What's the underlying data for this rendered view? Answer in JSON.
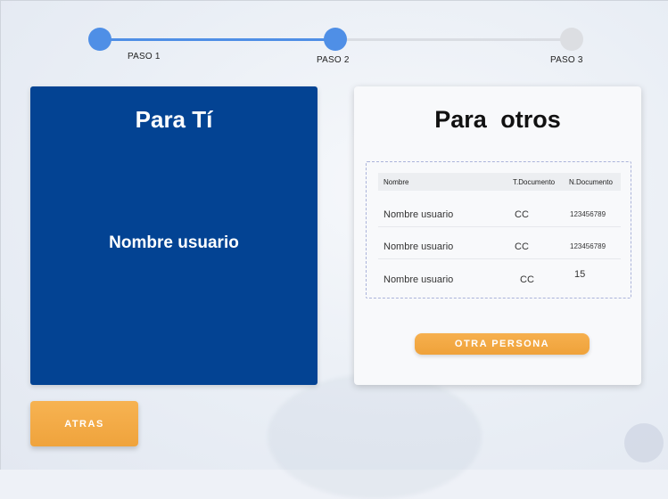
{
  "stepper": {
    "steps": [
      {
        "label": "PASO 1",
        "state": "completed"
      },
      {
        "label": "PASO 2",
        "state": "active"
      },
      {
        "label": "PASO 3",
        "state": "pending"
      }
    ],
    "active_color": "#4f8fe6",
    "inactive_color": "#dcdee2"
  },
  "self_card": {
    "title": "Para Tí",
    "user_name": "Nombre usuario",
    "color": "#034393"
  },
  "others_card": {
    "title": "Para  otros",
    "table": {
      "headers": [
        "Nombre",
        "T.Documento",
        "N.Documento"
      ],
      "rows": [
        [
          "Nombre usuario",
          "CC",
          "123456789"
        ],
        [
          "Nombre usuario",
          "CC",
          "123456789"
        ],
        [
          "Nombre usuario",
          "CC",
          "15"
        ]
      ]
    },
    "add_button_label": "OTRA PERSONA"
  },
  "back_button_label": "ATRAS",
  "button_color": "#f3aa45"
}
